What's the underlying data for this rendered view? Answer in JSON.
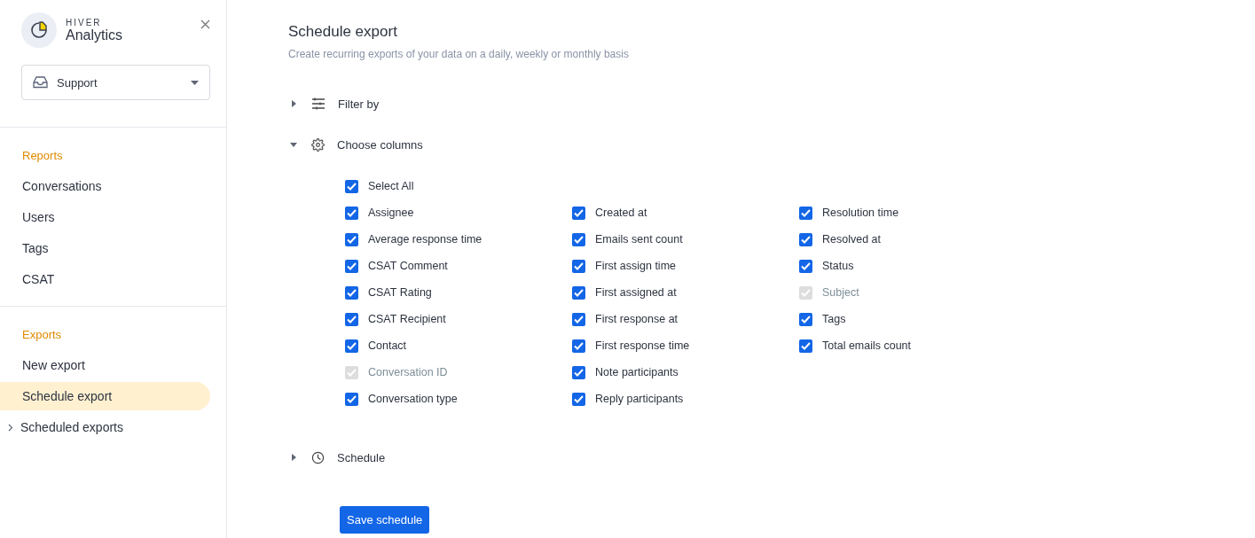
{
  "brand": {
    "name": "HIVER",
    "product": "Analytics"
  },
  "inbox_select": {
    "value": "Support"
  },
  "nav_groups": [
    {
      "title": "Reports",
      "items": [
        {
          "label": "Conversations",
          "selected": false,
          "expandable": false
        },
        {
          "label": "Users",
          "selected": false,
          "expandable": false
        },
        {
          "label": "Tags",
          "selected": false,
          "expandable": false
        },
        {
          "label": "CSAT",
          "selected": false,
          "expandable": false
        }
      ]
    },
    {
      "title": "Exports",
      "items": [
        {
          "label": "New export",
          "selected": false,
          "expandable": false
        },
        {
          "label": "Schedule export",
          "selected": true,
          "expandable": false
        },
        {
          "label": "Scheduled exports",
          "selected": false,
          "expandable": true
        }
      ]
    }
  ],
  "page": {
    "title": "Schedule export",
    "subtitle": "Create recurring exports of your data on a daily, weekly or monthly basis"
  },
  "sections": [
    {
      "kind": "filter",
      "label": "Filter by",
      "expanded": false
    },
    {
      "kind": "columns",
      "label": "Choose columns",
      "expanded": true
    },
    {
      "kind": "schedule",
      "label": "Schedule",
      "expanded": false
    }
  ],
  "select_all": {
    "label": "Select All",
    "checked": true
  },
  "column_options": [
    [
      {
        "label": "Assignee",
        "checked": true,
        "disabled": false
      },
      {
        "label": "Average response time",
        "checked": true,
        "disabled": false
      },
      {
        "label": "CSAT Comment",
        "checked": true,
        "disabled": false
      },
      {
        "label": "CSAT Rating",
        "checked": true,
        "disabled": false
      },
      {
        "label": "CSAT Recipient",
        "checked": true,
        "disabled": false
      },
      {
        "label": "Contact",
        "checked": true,
        "disabled": false
      },
      {
        "label": "Conversation ID",
        "checked": true,
        "disabled": true
      },
      {
        "label": "Conversation type",
        "checked": true,
        "disabled": false
      }
    ],
    [
      {
        "label": "Created at",
        "checked": true,
        "disabled": false
      },
      {
        "label": "Emails sent count",
        "checked": true,
        "disabled": false
      },
      {
        "label": "First assign time",
        "checked": true,
        "disabled": false
      },
      {
        "label": "First assigned at",
        "checked": true,
        "disabled": false
      },
      {
        "label": "First response at",
        "checked": true,
        "disabled": false
      },
      {
        "label": "First response time",
        "checked": true,
        "disabled": false
      },
      {
        "label": "Note participants",
        "checked": true,
        "disabled": false
      },
      {
        "label": "Reply participants",
        "checked": true,
        "disabled": false
      }
    ],
    [
      {
        "label": "Resolution time",
        "checked": true,
        "disabled": false
      },
      {
        "label": "Resolved at",
        "checked": true,
        "disabled": false
      },
      {
        "label": "Status",
        "checked": true,
        "disabled": false
      },
      {
        "label": "Subject",
        "checked": true,
        "disabled": true
      },
      {
        "label": "Tags",
        "checked": true,
        "disabled": false
      },
      {
        "label": "Total emails count",
        "checked": true,
        "disabled": false
      }
    ]
  ],
  "save_button": "Save schedule"
}
